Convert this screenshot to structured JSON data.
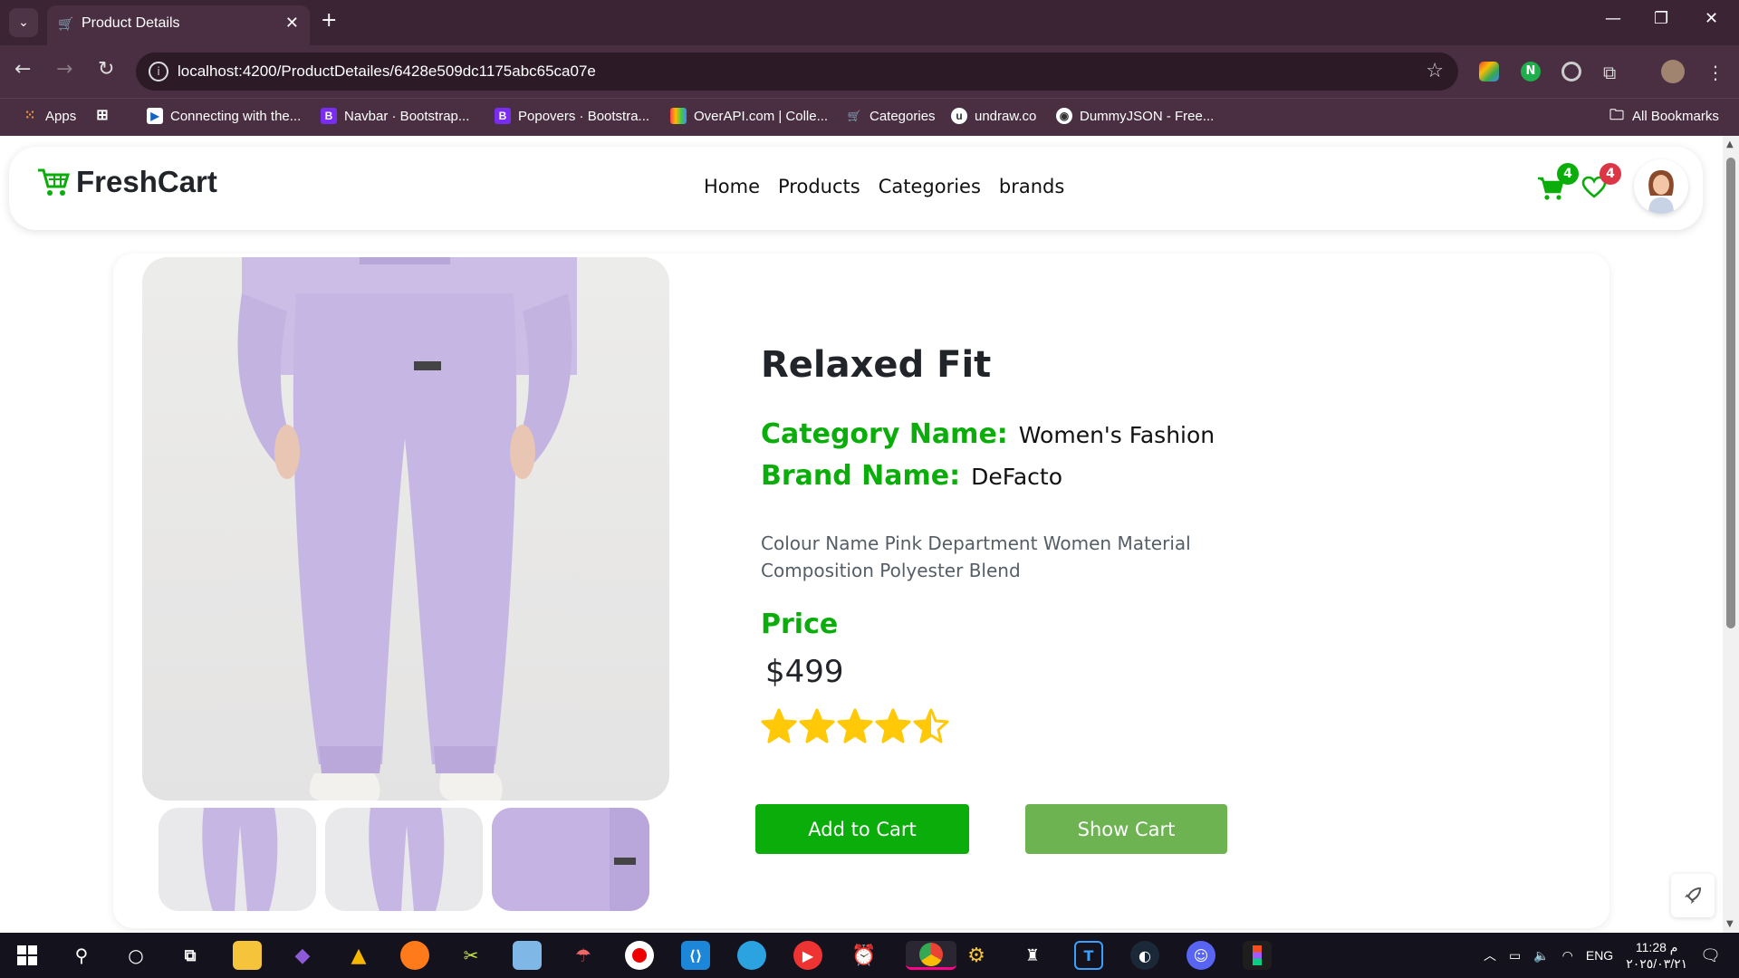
{
  "browser": {
    "tab_title": "Product Details",
    "url": "localhost:4200/ProductDetailes/6428e509dc1175abc65ca07e",
    "bookmarks": [
      {
        "label": "Apps"
      },
      {
        "label": "Connecting with the..."
      },
      {
        "label": "Navbar · Bootstrap..."
      },
      {
        "label": "Popovers · Bootstra..."
      },
      {
        "label": "OverAPI.com | Colle..."
      },
      {
        "label": "Categories"
      },
      {
        "label": "undraw.co"
      },
      {
        "label": "DummyJSON - Free..."
      }
    ],
    "all_bookmarks": "All Bookmarks"
  },
  "navbar": {
    "logo": "FreshCart",
    "links": [
      "Home",
      "Products",
      "Categories",
      "brands"
    ],
    "cart_count": "4",
    "wishlist_count": "4"
  },
  "product": {
    "title": "Relaxed Fit",
    "category_label": "Category Name:",
    "category_value": "Women's Fashion",
    "brand_label": "Brand Name:",
    "brand_value": "DeFacto",
    "description": "Colour Name Pink Department Women Material Composition Polyester Blend",
    "price_label": "Price",
    "price": "$499",
    "rating": 4.5,
    "add_to_cart": "Add to Cart",
    "show_cart": "Show Cart"
  },
  "taskbar": {
    "language": "ENG",
    "time": "11:28 م",
    "date": "٢٠٢٥/٠٣/٢١"
  },
  "colors": {
    "brand_green": "#0aad0a",
    "show_cart_green": "#6db351",
    "badge_green": "#0aad0a",
    "badge_red": "#dc3545",
    "star": "#ffc908",
    "product_lavender": "#c7b8e3"
  }
}
